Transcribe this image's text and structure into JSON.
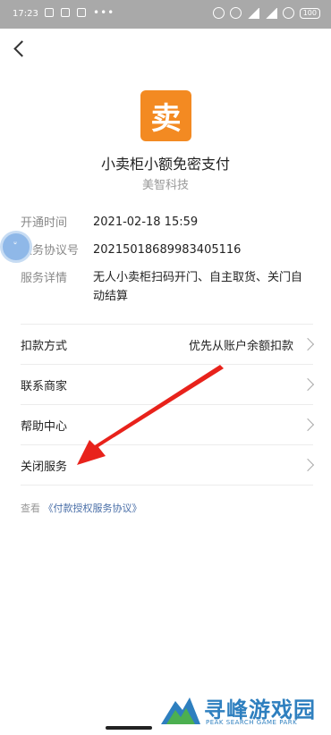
{
  "status_bar": {
    "time": "17:23",
    "battery": "100"
  },
  "merchant": {
    "logo_char": "卖",
    "title": "小卖柜小额免密支付",
    "company": "美智科技"
  },
  "info": [
    {
      "key": "开通时间",
      "value": "2021-02-18 15:59"
    },
    {
      "key": "服务协议号",
      "value": "20215018689983405116"
    },
    {
      "key": "服务详情",
      "value": "无人小卖柜扫码开门、自主取货、关门自动结算"
    }
  ],
  "menu": {
    "payment_method": {
      "label": "扣款方式",
      "value": "优先从账户余额扣款"
    },
    "contact_merchant": {
      "label": "联系商家"
    },
    "help_center": {
      "label": "帮助中心"
    },
    "close_service": {
      "label": "关闭服务"
    }
  },
  "agreement": {
    "prefix": "查看",
    "link": "《付款授权服务协议》"
  },
  "watermark": {
    "title": "寻峰游戏园",
    "subtitle": "PEAK SEARCH GAME PARK"
  },
  "colors": {
    "logo_bg": "#f38a22",
    "annotation_arrow": "#e8221b",
    "link": "#4a6fa8"
  }
}
